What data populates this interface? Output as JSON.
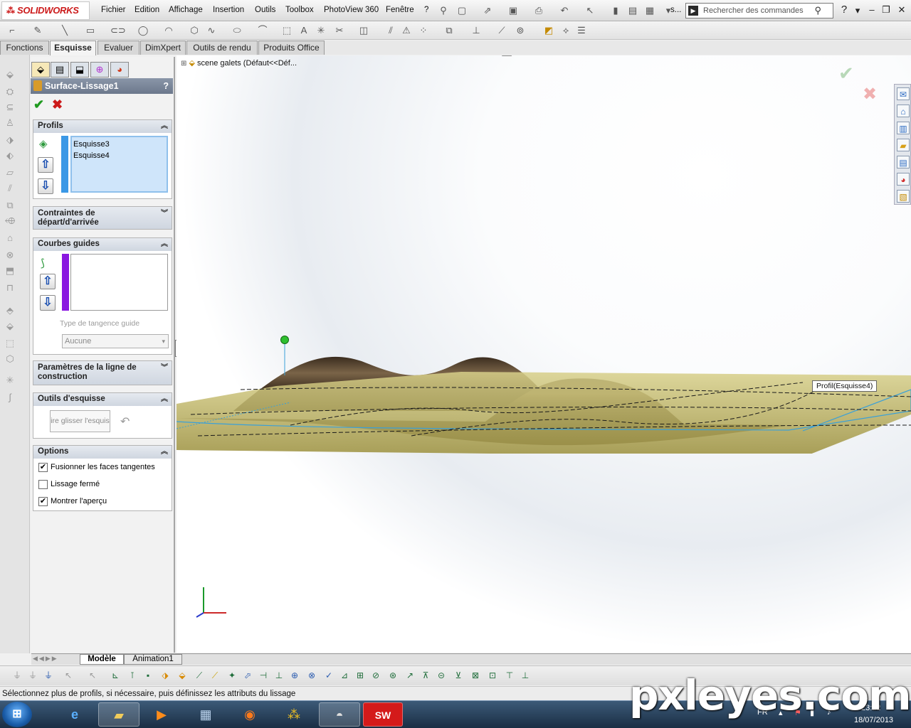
{
  "app": {
    "logo_text": "SOLIDWORKS",
    "menu": [
      "Fichier",
      "Edition",
      "Affichage",
      "Insertion",
      "Outils",
      "Toolbox",
      "PhotoView 360",
      "Fenêtre",
      "?"
    ],
    "title_fragment": "s...",
    "search_placeholder": "Rechercher des commandes",
    "help_label": "?"
  },
  "command_tabs": [
    {
      "label": "Fonctions",
      "active": false
    },
    {
      "label": "Esquisse",
      "active": true
    },
    {
      "label": "Evaluer",
      "active": false
    },
    {
      "label": "DimXpert",
      "active": false
    },
    {
      "label": "Outils de rendu",
      "active": false
    },
    {
      "label": "Produits Office",
      "active": false
    }
  ],
  "property_manager": {
    "title": "Surface-Lissage1",
    "help": "?",
    "ok_glyph": "✔",
    "cancel_glyph": "✖",
    "profils": {
      "title": "Profils",
      "items": [
        "Esquisse3",
        "Esquisse4"
      ]
    },
    "contraintes": {
      "title": "Contraintes de départ/d'arrivée"
    },
    "courbes_guides": {
      "title": "Courbes guides",
      "tangence_label": "Type de tangence guide",
      "tangence_value": "Aucune"
    },
    "parametres": {
      "title": "Paramètres de la ligne de construction"
    },
    "outils_esquisse": {
      "title": "Outils d'esquisse",
      "button_label": "ire glisser l'esquis"
    },
    "options": {
      "title": "Options",
      "checkboxes": [
        {
          "label": "Fusionner les faces tangentes",
          "checked": true
        },
        {
          "label": "Lissage fermé",
          "checked": false
        },
        {
          "label": "Montrer l'aperçu",
          "checked": true
        }
      ]
    }
  },
  "viewport": {
    "tree_label": "scene galets  (Défaut<<Déf...",
    "callout": "Profil(Esquisse4)",
    "accept_glyph": "✔",
    "reject_glyph": "✖"
  },
  "model_tabs": [
    {
      "label": "Modèle",
      "active": true
    },
    {
      "label": "Animation1",
      "active": false
    }
  ],
  "status_bar": "Sélectionnez plus de profils, si nécessaire, puis définissez les attributs du lissage",
  "taskbar": {
    "language": "FR",
    "time": "23:12",
    "date": "18/07/2013"
  },
  "watermark": "pxleyes.com",
  "colors": {
    "accent_red": "#cc1a1a",
    "selection_blue": "#cfe5fa",
    "guide_purple": "#8a17e0",
    "profile_blue": "#3b98e6",
    "ok_green": "#1f9a1f"
  }
}
